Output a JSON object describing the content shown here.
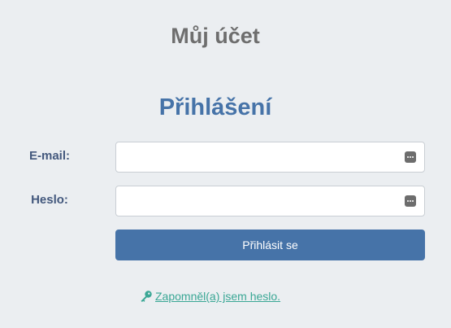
{
  "page": {
    "title": "Můj účet"
  },
  "login": {
    "title": "Přihlášení",
    "email_label": "E-mail:",
    "email_value": "",
    "password_label": "Heslo:",
    "password_value": "",
    "submit_label": "Přihlásit se",
    "forgot_label": "Zapomněl(a) jsem heslo."
  },
  "icons": {
    "password_manager": "password-manager-icon",
    "forgot": "key-icon"
  },
  "colors": {
    "background": "#ebeef1",
    "accent": "#4673a8",
    "link": "#3aa795",
    "label": "#43587d",
    "heading": "#6e6e6e"
  }
}
